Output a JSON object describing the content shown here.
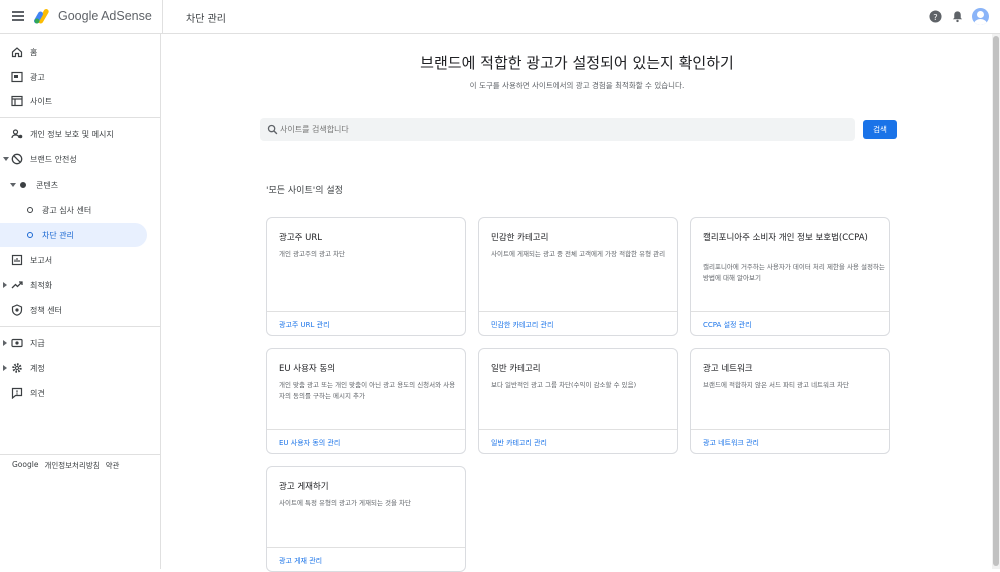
{
  "app": {
    "brand": "Google AdSense",
    "page_name": "차단 관리"
  },
  "sidebar": {
    "items": [
      {
        "label": "홈"
      },
      {
        "label": "광고"
      },
      {
        "label": "사이트"
      },
      {
        "label": "개인 정보 보호 및 메시지"
      },
      {
        "label": "브랜드 안전성"
      },
      {
        "label": "콘텐츠"
      },
      {
        "label": "광고 심사 센터"
      },
      {
        "label": "차단 관리"
      },
      {
        "label": "보고서"
      },
      {
        "label": "최적화"
      },
      {
        "label": "정책 센터"
      },
      {
        "label": "지급"
      },
      {
        "label": "계정"
      },
      {
        "label": "의견"
      }
    ],
    "footer": {
      "google": "Google",
      "privacy": "개인정보처리방침",
      "terms": "약관"
    }
  },
  "main": {
    "title": "브랜드에 적합한 광고가 설정되어 있는지 확인하기",
    "subtitle": "이 도구를 사용하면 사이트에서의 광고 경험을 최적화할 수 있습니다.",
    "search": {
      "placeholder": "사이트를 검색합니다",
      "button": "검색"
    },
    "section_title": "'모든 사이트'의 설정",
    "cards": [
      {
        "title": "광고주 URL",
        "desc": "개인 광고주의 광고 차단",
        "link": "광고주 URL 관리"
      },
      {
        "title": "민감한 카테고리",
        "desc": "사이트에 게재되는 광고 중 전체 고객에게 가장 적합한 유형 관리",
        "link": "민감한 카테고리 관리"
      },
      {
        "title": "캘리포니아주 소비자 개인 정보 보호법(CCPA)",
        "desc": "캘리포니아에 거주하는 사용자가 데이터 처리 제한을 사용 설정하는 방법에 대해 알아보기",
        "link": "CCPA 설정 관리"
      },
      {
        "title": "EU 사용자 동의",
        "desc": "개인 맞춤 광고 또는 개인 맞춤이 아닌 광고 용도의 신청서와 사용자의 동의를 구하는 메시지 추가",
        "link": "EU 사용자 동의 관리"
      },
      {
        "title": "일반 카테고리",
        "desc": "보다 일반적인 광고 그룹 차단(수익이 감소할 수 있음)",
        "link": "일반 카테고리 관리"
      },
      {
        "title": "광고 네트워크",
        "desc": "브랜드에 적합하지 않은 서드 파티 광고 네트워크 차단",
        "link": "광고 네트워크 관리"
      },
      {
        "title": "광고 게재하기",
        "desc": "사이트에 특정 유형의 광고가 게재되는 것을 차단",
        "link": "광고 게재 관리"
      }
    ]
  },
  "colors": {
    "accent": "#1a73e8",
    "active_bg": "#e8f0fe"
  }
}
